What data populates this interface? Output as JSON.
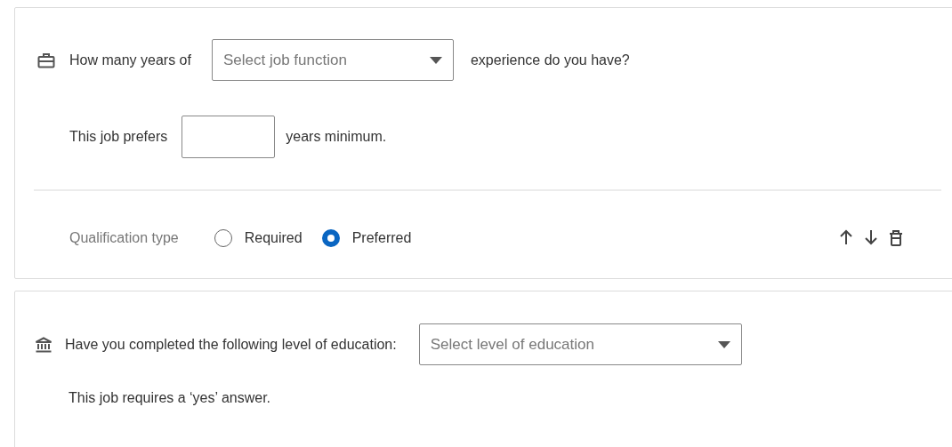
{
  "cards": [
    {
      "kind": "experience",
      "prompt_before": "How many years of",
      "select": {
        "placeholder": "Select job function"
      },
      "prompt_after": "experience do you have?",
      "minimum": {
        "before": "This job prefers",
        "after": "years minimum."
      },
      "qualification": {
        "label": "Qualification type",
        "options": [
          {
            "label": "Required",
            "selected": false
          },
          {
            "label": "Preferred",
            "selected": true
          }
        ]
      }
    },
    {
      "kind": "education",
      "prompt": "Have you completed the following level of education:",
      "select": {
        "placeholder": "Select level of education"
      },
      "note": "This job requires a ‘yes’ answer."
    }
  ]
}
